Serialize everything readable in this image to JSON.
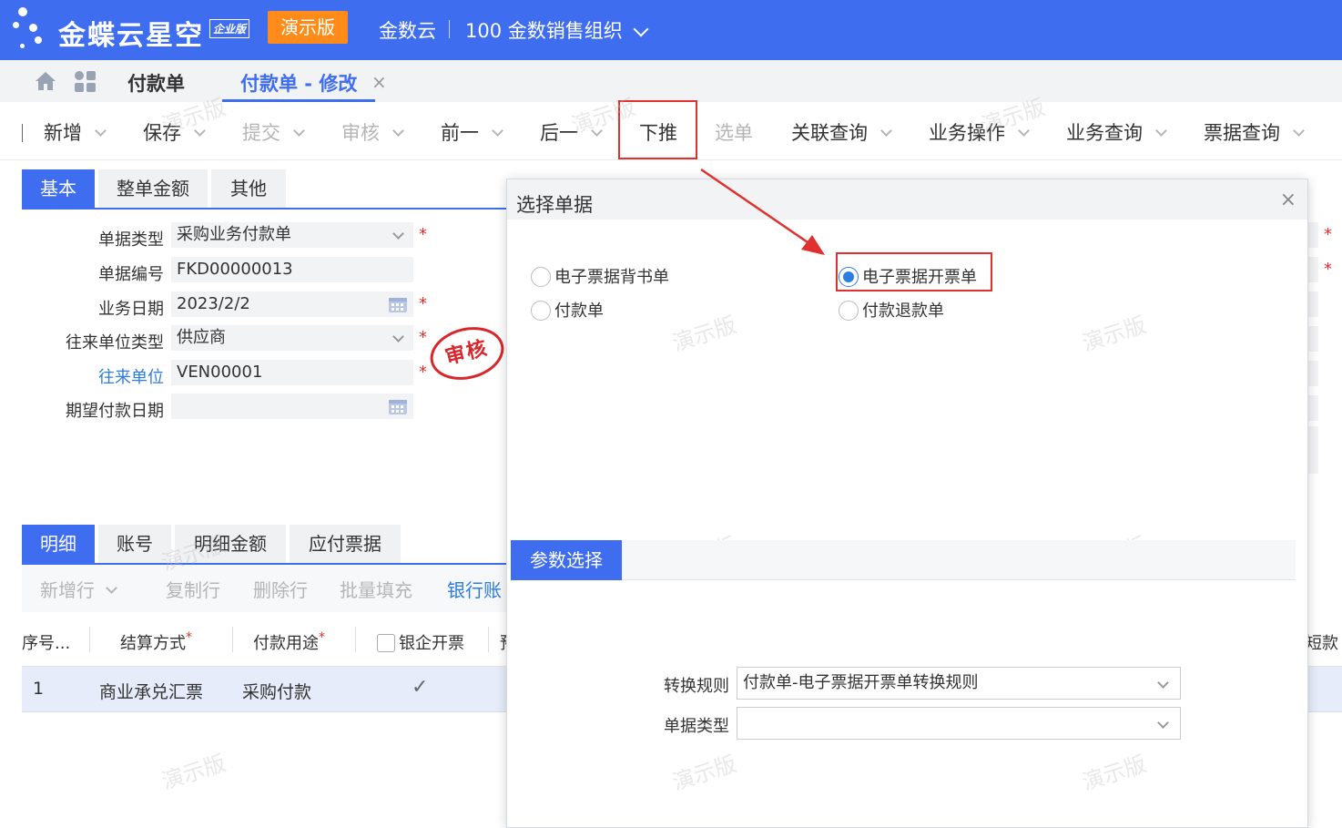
{
  "header": {
    "logo_text": "金蝶云星空",
    "logo_badge": "企业版",
    "demo_badge": "演示版",
    "app_name": "金数云",
    "org_name": "100 金数销售组织"
  },
  "tabs": {
    "plain_label": "付款单",
    "active_label": "付款单 - 修改",
    "close": "×"
  },
  "toolbar": {
    "items": [
      "新增",
      "保存",
      "提交",
      "审核",
      "前一",
      "后一",
      "下推",
      "选单",
      "关联查询",
      "业务操作",
      "业务查询",
      "票据查询"
    ]
  },
  "form": {
    "subtabs": [
      "基本",
      "整单金额",
      "其他"
    ],
    "fields": [
      {
        "label": "单据类型",
        "value": "采购业务付款单"
      },
      {
        "label": "单据编号",
        "value": "FKD00000013"
      },
      {
        "label": "业务日期",
        "value": "2023/2/2"
      },
      {
        "label": "往来单位类型",
        "value": "供应商"
      },
      {
        "label": "往来单位",
        "value": "VEN00001"
      },
      {
        "label": "期望付款日期",
        "value": ""
      }
    ],
    "required_mark": "*",
    "stamp": "审核"
  },
  "detail": {
    "tabs": [
      "明细",
      "账号",
      "明细金额",
      "应付票据"
    ],
    "tools": [
      "新增行",
      "复制行",
      "删除行",
      "批量填充",
      "银行账"
    ],
    "columns": [
      "序号...",
      "结算方式",
      "付款用途",
      "银企开票",
      "预",
      "短款"
    ],
    "rows": [
      {
        "seq": "1",
        "method": "商业承兑汇票",
        "purpose": "采购付款",
        "check": "✓"
      }
    ]
  },
  "modal": {
    "title": "选择单据",
    "close": "×",
    "options": [
      {
        "label": "电子票据背书单",
        "selected": false
      },
      {
        "label": "电子票据开票单",
        "selected": true
      },
      {
        "label": "付款单",
        "selected": false
      },
      {
        "label": "付款退款单",
        "selected": false
      }
    ],
    "param_tab": "参数选择",
    "rule_label": "转换规则",
    "rule_value": "付款单-电子票据开票单转换规则",
    "type_label": "单据类型",
    "type_value": ""
  },
  "watermark": "演示版",
  "colors": {
    "brand": "#3f6df0",
    "accent_orange": "#ff8c1a",
    "highlight_red": "#e0312e",
    "link_blue": "#2b7de0"
  }
}
